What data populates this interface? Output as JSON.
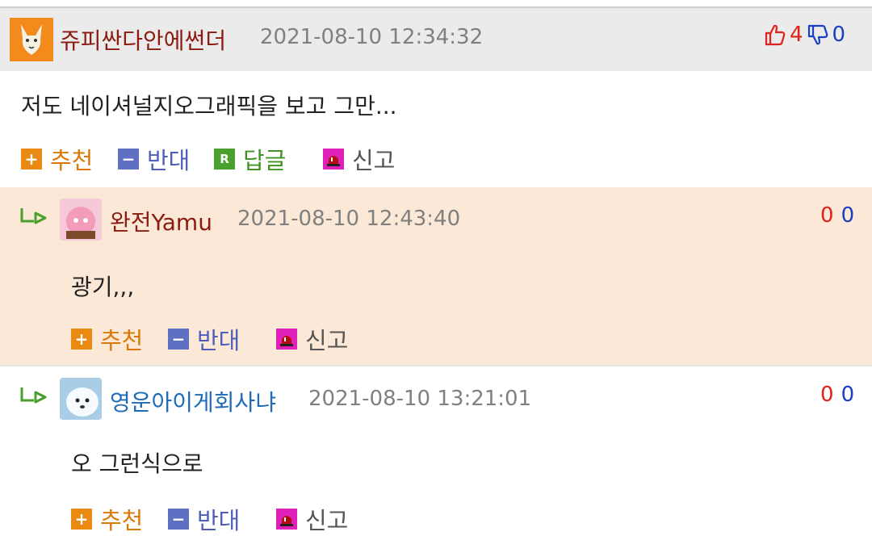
{
  "comments": [
    {
      "nickname": "쥬피싼다안에썬더",
      "datetime": "2021-08-10 12:34:32",
      "likes": "4",
      "dislikes": "0",
      "text": "저도 네이셔널지오그래픽을 보고 그만...",
      "actions": {
        "recommend": "추천",
        "oppose": "반대",
        "reply": "답글",
        "report": "신고"
      }
    },
    {
      "nickname": "완전Yamu",
      "datetime": "2021-08-10 12:43:40",
      "likes": "0",
      "dislikes": "0",
      "text": "광기,,,",
      "actions": {
        "recommend": "추천",
        "oppose": "반대",
        "report": "신고"
      }
    },
    {
      "nickname": "영운아이게회사냐",
      "datetime": "2021-08-10 13:21:01",
      "likes": "0",
      "dislikes": "0",
      "text": "오 그런식으로",
      "actions": {
        "recommend": "추천",
        "oppose": "반대",
        "report": "신고"
      }
    }
  ],
  "icons": {
    "avatar1": "fox-avatar-icon",
    "avatar2": "pink-character-avatar-icon",
    "avatar3": "white-dog-avatar-icon",
    "thumbs_up": "thumbs-up-icon",
    "thumbs_down": "thumbs-down-icon",
    "reply_arrow": "reply-arrow-icon",
    "plus": "plus-icon",
    "minus": "minus-icon",
    "reply_badge": "reply-badge-icon",
    "siren": "siren-icon"
  },
  "colors": {
    "header_bg": "#ebebeb",
    "reply_bg": "#fbe8d6",
    "nickname_red": "#8b1a10",
    "nickname_blue": "#1e6bb8",
    "like_red": "#e0221a",
    "dislike_blue": "#1a3fc4"
  }
}
